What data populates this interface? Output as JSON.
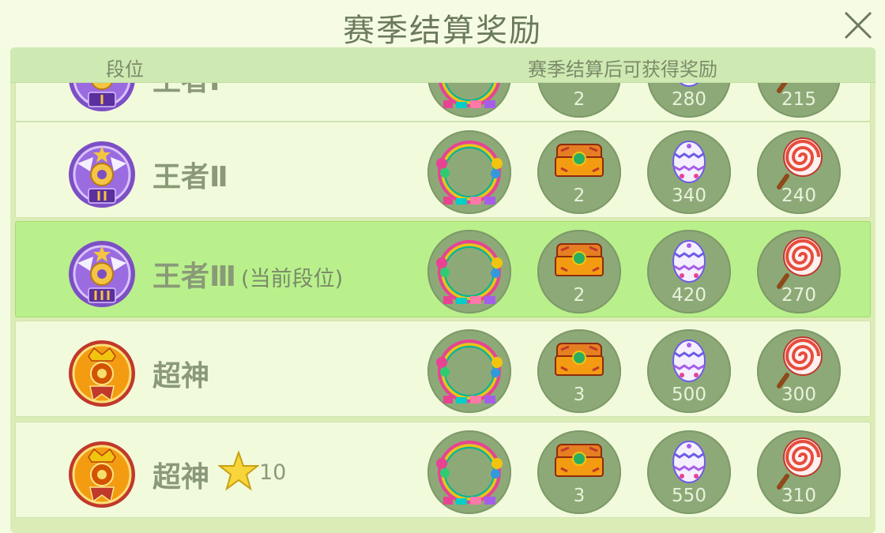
{
  "window": {
    "title": "赛季结算奖励"
  },
  "header": {
    "rank_col": "段位",
    "reward_col": "赛季结算后可获得奖励"
  },
  "current_suffix": "(当前段位)",
  "colors": {
    "background": "#f3fbe0",
    "row": "#f2fadc",
    "current_row": "#b9f08c",
    "reward_circle": "#8ea978",
    "text": "#8a9a78"
  },
  "rows": [
    {
      "rank": "王者Ⅰ",
      "badge": "king-badge-1",
      "current": false,
      "star_count": "",
      "rewards": [
        {
          "icon": "avatar-frame-icon",
          "count": ""
        },
        {
          "icon": "treasure-chest-icon",
          "count": "2"
        },
        {
          "icon": "egg-icon",
          "count": "280"
        },
        {
          "icon": "lollipop-icon",
          "count": "215"
        }
      ]
    },
    {
      "rank": "王者Ⅱ",
      "badge": "king-badge-2",
      "current": false,
      "star_count": "",
      "rewards": [
        {
          "icon": "avatar-frame-icon",
          "count": ""
        },
        {
          "icon": "treasure-chest-icon",
          "count": "2"
        },
        {
          "icon": "egg-icon",
          "count": "340"
        },
        {
          "icon": "lollipop-icon",
          "count": "240"
        }
      ]
    },
    {
      "rank": "王者Ⅲ",
      "badge": "king-badge-3",
      "current": true,
      "star_count": "",
      "rewards": [
        {
          "icon": "avatar-frame-icon",
          "count": ""
        },
        {
          "icon": "treasure-chest-icon",
          "count": "2"
        },
        {
          "icon": "egg-icon",
          "count": "420"
        },
        {
          "icon": "lollipop-icon",
          "count": "270"
        }
      ]
    },
    {
      "rank": "超神",
      "badge": "super-god-badge",
      "current": false,
      "star_count": "",
      "rewards": [
        {
          "icon": "avatar-frame-icon",
          "count": ""
        },
        {
          "icon": "treasure-chest-icon",
          "count": "3"
        },
        {
          "icon": "egg-icon",
          "count": "500"
        },
        {
          "icon": "lollipop-icon",
          "count": "300"
        }
      ]
    },
    {
      "rank": "超神",
      "badge": "super-god-badge",
      "current": false,
      "star_count": "10",
      "rewards": [
        {
          "icon": "avatar-frame-icon",
          "count": ""
        },
        {
          "icon": "treasure-chest-icon",
          "count": "3"
        },
        {
          "icon": "egg-icon",
          "count": "550"
        },
        {
          "icon": "lollipop-icon",
          "count": "310"
        }
      ]
    }
  ]
}
